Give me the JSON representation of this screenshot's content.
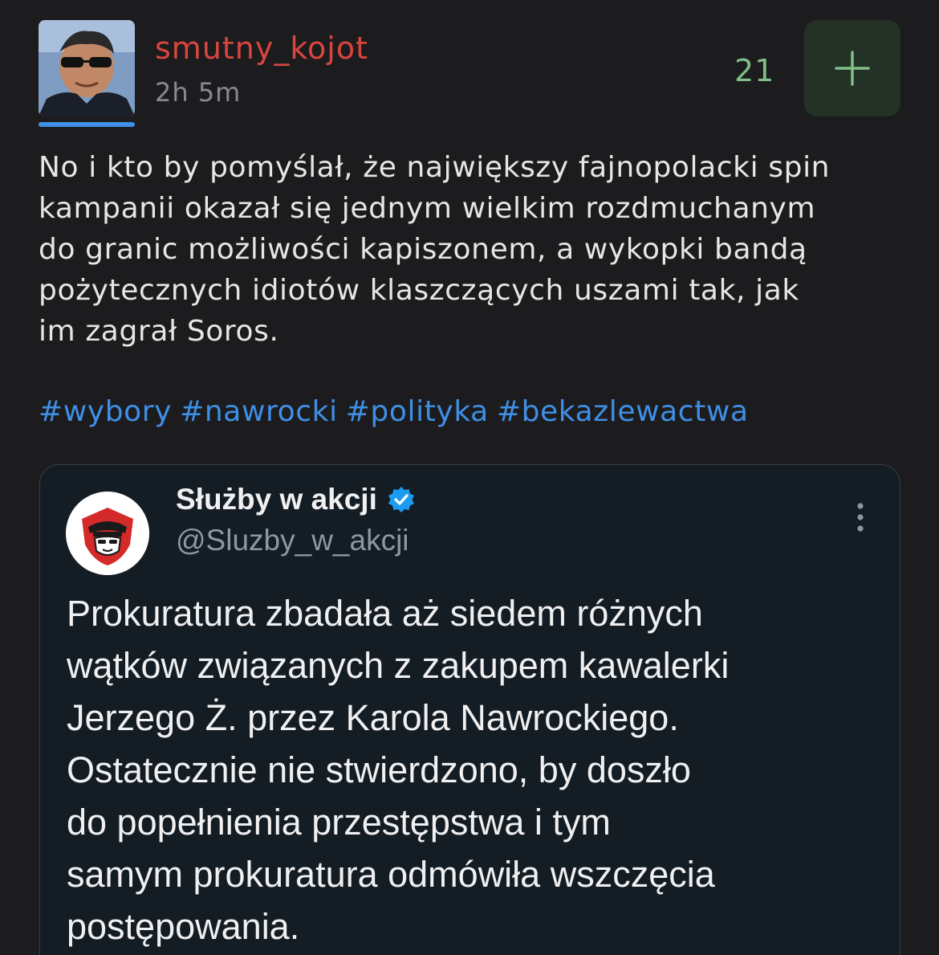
{
  "post": {
    "author": {
      "username": "smutny_kojot",
      "avatar_icon": "user-avatar-photo"
    },
    "timestamp": "2h 5m",
    "votes": {
      "count": "21",
      "plus_icon": "plus-icon"
    },
    "body": "No i kto by pomyślał, że największy fajnopolacki spin\nkampanii okazał się jednym wielkim rozdmuchanym\ndo granic możliwości kapiszonem, a wykopki bandą\npożytecznych idiotów klaszczących uszami tak, jak\nim zagrał Soros.",
    "tags": [
      "#wybory",
      "#nawrocki",
      "#polityka",
      "#bekazlewactwa"
    ]
  },
  "embed": {
    "display_name": "Służby w akcji",
    "handle": "@Sluzby_w_akcji",
    "verified_icon": "verified-badge-icon",
    "more_icon": "more-vertical-icon",
    "text": "Prokuratura zbadała aż siedem różnych\nwątków związanych z zakupem kawalerki\nJerzego Ż. przez Karola Nawrockiego.\nOstatecznie nie stwierdzono, by doszło\ndo popełnienia przestępstwa i tym\nsamym prokuratura odmówiła wszczęcia\npostępowania."
  },
  "colors": {
    "background": "#1c1c1e",
    "username": "#d9453f",
    "vote_count": "#7fbf87",
    "tag": "#3f8fe6",
    "embed_background": "#141c24",
    "verified": "#1d9bf0"
  }
}
